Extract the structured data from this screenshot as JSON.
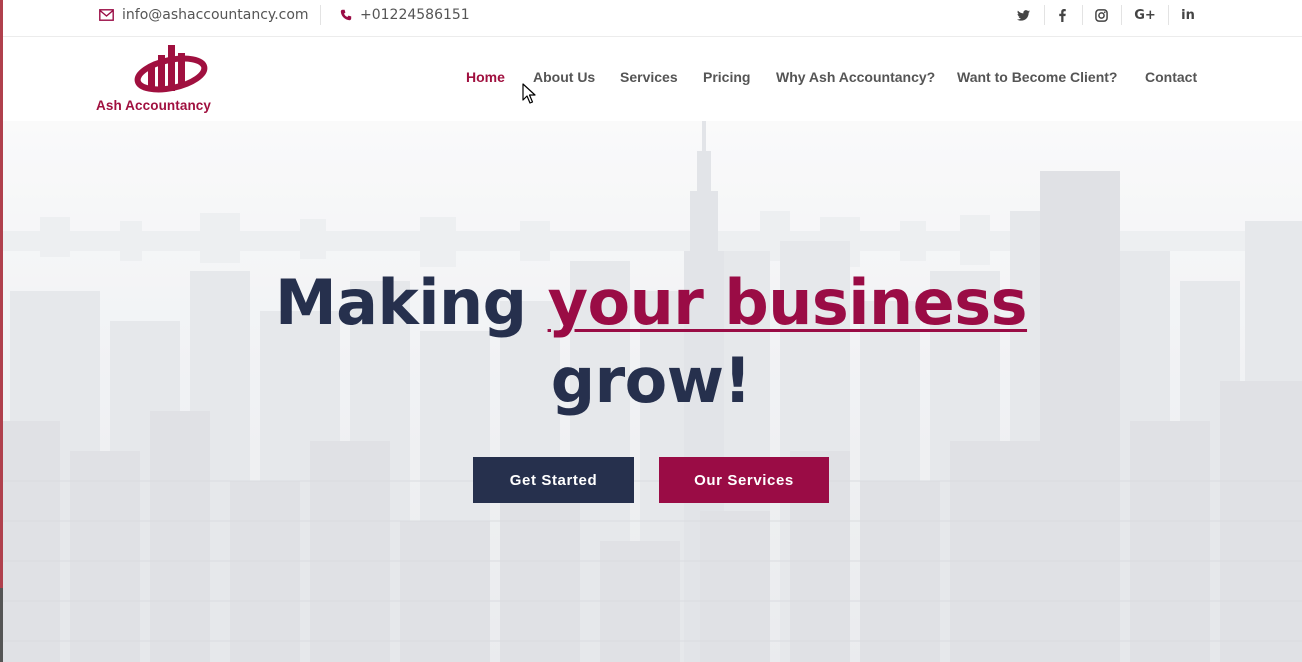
{
  "topbar": {
    "email": "info@ashaccountancy.com",
    "phone": "+01224586151",
    "socials": [
      {
        "name": "twitter-icon",
        "glyph": "🐦"
      },
      {
        "name": "facebook-icon",
        "glyph": "f"
      },
      {
        "name": "instagram-icon",
        "glyph": "◎"
      },
      {
        "name": "google-plus-icon",
        "glyph": "G+"
      },
      {
        "name": "linkedin-icon",
        "glyph": "in"
      }
    ]
  },
  "brand": {
    "name": "Ash Accountancy",
    "color": "#a0103f"
  },
  "nav": {
    "items": [
      "Home",
      "About Us",
      "Services",
      "Pricing",
      "Why Ash Accountancy?",
      "Want to Become Client?",
      "Contact"
    ],
    "active": "Home"
  },
  "hero": {
    "headline_start": "Making ",
    "headline_accent": "your business",
    "headline_end": "grow!",
    "primary_button": "Get Started",
    "secondary_button": "Our Services"
  },
  "colors": {
    "navy": "#26304d",
    "accent": "#9a0c45"
  }
}
